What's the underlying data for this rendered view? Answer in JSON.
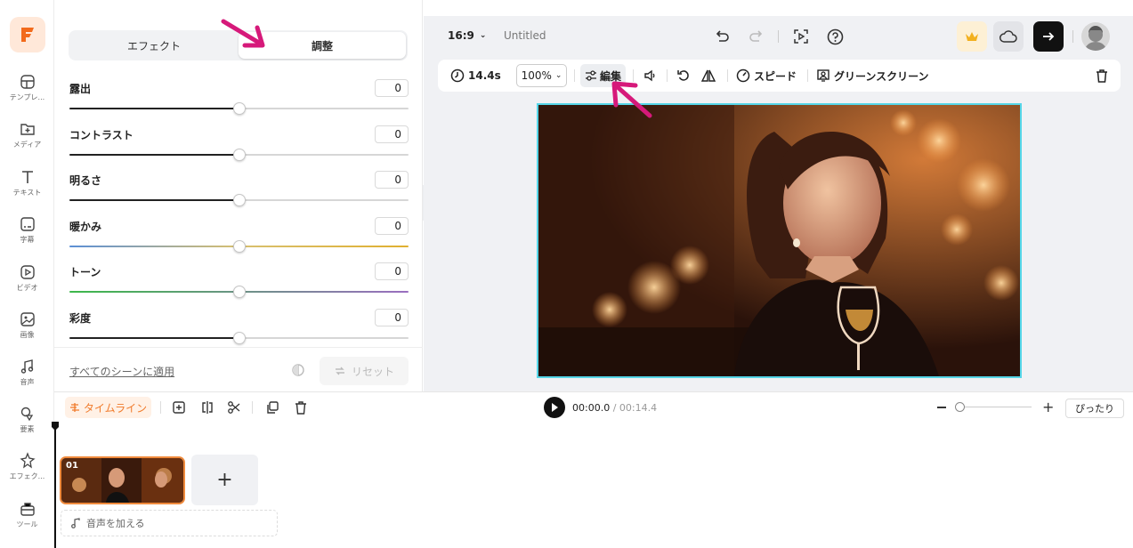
{
  "rail": {
    "items": [
      {
        "label": "テンプレ...",
        "icon": "template-icon"
      },
      {
        "label": "メディア",
        "icon": "media-icon"
      },
      {
        "label": "テキスト",
        "icon": "text-icon"
      },
      {
        "label": "字幕",
        "icon": "subtitle-icon"
      },
      {
        "label": "ビデオ",
        "icon": "video-icon"
      },
      {
        "label": "画像",
        "icon": "image-icon"
      },
      {
        "label": "音声",
        "icon": "music-icon"
      },
      {
        "label": "要素",
        "icon": "elements-icon"
      },
      {
        "label": "エフェク...",
        "icon": "effects-icon"
      },
      {
        "label": "ツール",
        "icon": "tools-icon"
      }
    ]
  },
  "panel": {
    "tabs": [
      "エフェクト",
      "調整"
    ],
    "active_tab": "調整",
    "adjustments": [
      {
        "label": "露出",
        "value": "0",
        "level": 50
      },
      {
        "label": "コントラスト",
        "value": "0",
        "level": 50
      },
      {
        "label": "明るさ",
        "value": "0",
        "level": 50
      },
      {
        "label": "暖かみ",
        "value": "0",
        "level": 50
      },
      {
        "label": "トーン",
        "value": "0",
        "level": 50
      },
      {
        "label": "彩度",
        "value": "0",
        "level": 50
      }
    ],
    "apply_all": "すべてのシーンに適用",
    "reset": "リセット"
  },
  "topbar": {
    "ratio": "16:9",
    "title": "Untitled"
  },
  "toolbar": {
    "duration": "14.4s",
    "zoom": "100%",
    "edit": "編集",
    "speed": "スピード",
    "green_screen": "グリーンスクリーン"
  },
  "timeline": {
    "tag": "タイムライン",
    "current_time": "00:00.0",
    "separator": " / ",
    "total_time": "00:14.4",
    "fit": "ぴったり",
    "clip_number": "01",
    "add_audio": "音声を加える",
    "add_clip": "+"
  },
  "colors": {
    "brand": "#f26a1b",
    "annotation_arrow": "#d6197a",
    "selection": "#55d6e8",
    "clip_border": "#f08a3c"
  }
}
